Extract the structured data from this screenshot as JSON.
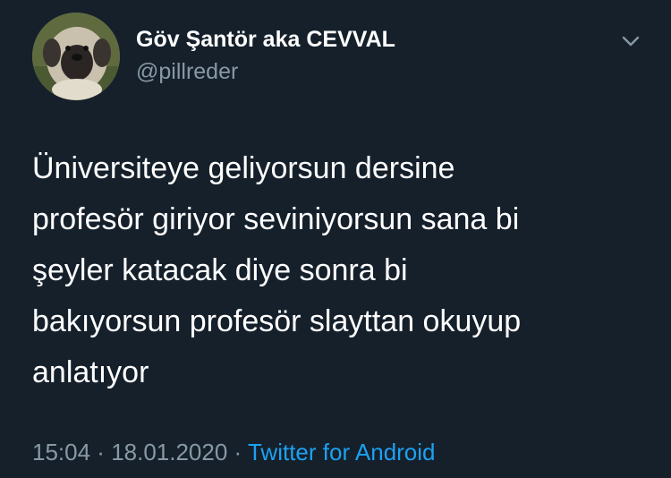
{
  "user": {
    "display_name": "Göv Şantör aka CEVVAL",
    "handle": "@pillreder",
    "avatar_icon": "puppy-avatar"
  },
  "menu": {
    "icon": "chevron-down-icon"
  },
  "tweet": {
    "lines": [
      "Üniversiteye geliyorsun dersine",
      "profesör giriyor seviniyorsun sana bi",
      "şeyler katacak diye sonra bi",
      "bakıyorsun profesör slayttan okuyup",
      "anlatıyor"
    ]
  },
  "meta": {
    "time": "15:04",
    "separator1": " · ",
    "date": "18.01.2020",
    "separator2": " · ",
    "source": "Twitter for Android"
  },
  "colors": {
    "background": "#15202b",
    "text": "#ffffff",
    "secondary": "#8899a6",
    "accent": "#1da1f2"
  }
}
